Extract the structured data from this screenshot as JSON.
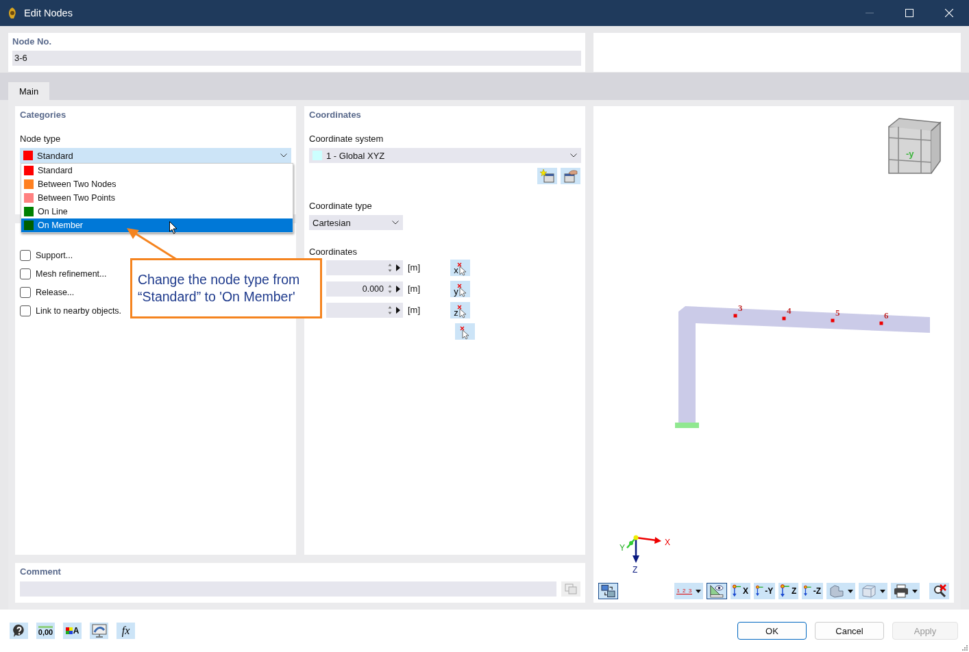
{
  "window": {
    "title": "Edit Nodes"
  },
  "node_no": {
    "label": "Node No.",
    "value": "3-6"
  },
  "tabs": [
    {
      "label": "Main",
      "selected": true
    }
  ],
  "categories": {
    "title": "Categories",
    "node_type_label": "Node type",
    "node_type": {
      "value": "Standard",
      "color": "#ff0000",
      "open": true
    },
    "node_type_options": [
      {
        "label": "Standard",
        "color": "#ff0000",
        "selected": false
      },
      {
        "label": "Between Two Nodes",
        "color": "#ff8020",
        "selected": false
      },
      {
        "label": "Between Two Points",
        "color": "#ff8080",
        "selected": false
      },
      {
        "label": "On Line",
        "color": "#008000",
        "selected": false
      },
      {
        "label": "On Member",
        "color": "#005f00",
        "selected": true
      }
    ]
  },
  "options": [
    {
      "label": "Support...",
      "checked": false
    },
    {
      "label": "Mesh refinement...",
      "checked": false
    },
    {
      "label": "Release...",
      "checked": false
    },
    {
      "label": "Link to nearby objects.",
      "checked": false
    }
  ],
  "coordinates": {
    "title": "Coordinates",
    "system_label": "Coordinate system",
    "system": {
      "value": "1 - Global XYZ",
      "color": "#ccffff"
    },
    "type_label": "Coordinate type",
    "type_value": "Cartesian",
    "values_label": "Coordinates",
    "rows": [
      {
        "value": "",
        "unit": "[m]",
        "axis": "x"
      },
      {
        "value": "0.000",
        "unit": "[m]",
        "axis": "y"
      },
      {
        "value": "",
        "unit": "[m]",
        "axis": "z"
      }
    ]
  },
  "view": {
    "node_labels": [
      {
        "label": "3"
      },
      {
        "label": "4"
      },
      {
        "label": "5"
      },
      {
        "label": "6"
      }
    ],
    "cube_label": "-y",
    "axes": {
      "x": "X",
      "y": "Y",
      "z": "Z"
    },
    "toolbar": [
      {
        "kind": "views",
        "pressed": true
      },
      {
        "kind": "numbering",
        "label": "1 2 3",
        "pressed": false
      },
      {
        "kind": "measure",
        "pressed": true
      },
      {
        "kind": "axis",
        "label": "X",
        "pressed": false
      },
      {
        "kind": "axis",
        "label": "-Y",
        "pressed": false
      },
      {
        "kind": "axis",
        "label": "Z",
        "pressed": false
      },
      {
        "kind": "axis",
        "label": "-Z",
        "pressed": false
      },
      {
        "kind": "solid",
        "pressed": false
      },
      {
        "kind": "wireframe",
        "pressed": false
      },
      {
        "kind": "print",
        "pressed": false
      },
      {
        "kind": "reset",
        "pressed": false
      }
    ]
  },
  "comment": {
    "title": "Comment"
  },
  "callout": {
    "lines": [
      "Change the node type from",
      "“Standard” to 'On Member'"
    ]
  },
  "bottom_tools": [
    {
      "kind": "help"
    },
    {
      "kind": "decimals",
      "label": "0,00"
    },
    {
      "kind": "text-color",
      "label": "A"
    },
    {
      "kind": "display"
    },
    {
      "kind": "formula",
      "label": "fx"
    }
  ],
  "buttons": [
    {
      "label": "OK",
      "default": true,
      "disabled": false
    },
    {
      "label": "Cancel",
      "default": false,
      "disabled": false
    },
    {
      "label": "Apply",
      "default": false,
      "disabled": true
    }
  ]
}
